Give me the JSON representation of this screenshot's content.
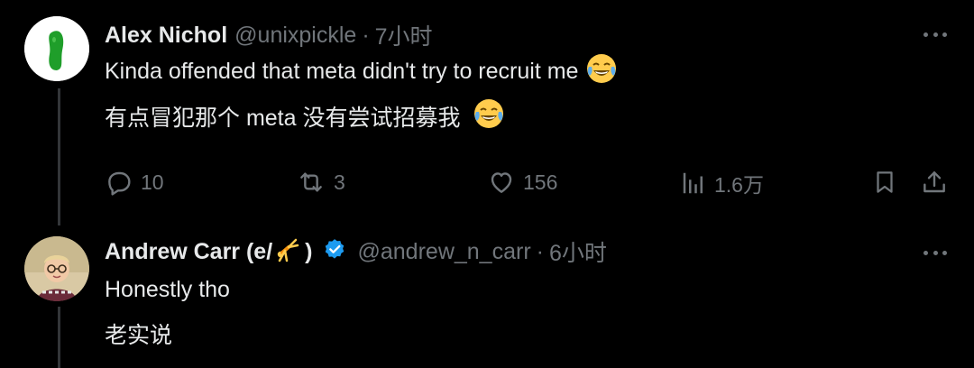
{
  "tweets": [
    {
      "name": "Alex Nichol",
      "handle": "@unixpickle",
      "separator": "·",
      "time": "7小时",
      "text_en": "Kinda offended that meta didn't try to recruit me",
      "text_zh": "有点冒犯那个 meta 没有尝试招募我",
      "emoji": "face-with-tears-of-joy-icon",
      "avatar": "pickle-avatar",
      "actions": {
        "replies": "10",
        "reposts": "3",
        "likes": "156",
        "views": "1.6万"
      }
    },
    {
      "name": "Andrew Carr (e/",
      "name_suffix": ")",
      "handle": "@andrew_n_carr",
      "separator": "·",
      "time": "6小时",
      "text_en": "Honestly tho",
      "text_zh": "老实说",
      "verified": true,
      "name_emoji": "cartwheel-person-icon",
      "avatar": "child-photo-avatar"
    }
  ],
  "colors": {
    "background": "#000000",
    "text": "#e7e9ea",
    "muted": "#71767b",
    "verified": "#1d9bf0",
    "thread_line": "#333639"
  }
}
